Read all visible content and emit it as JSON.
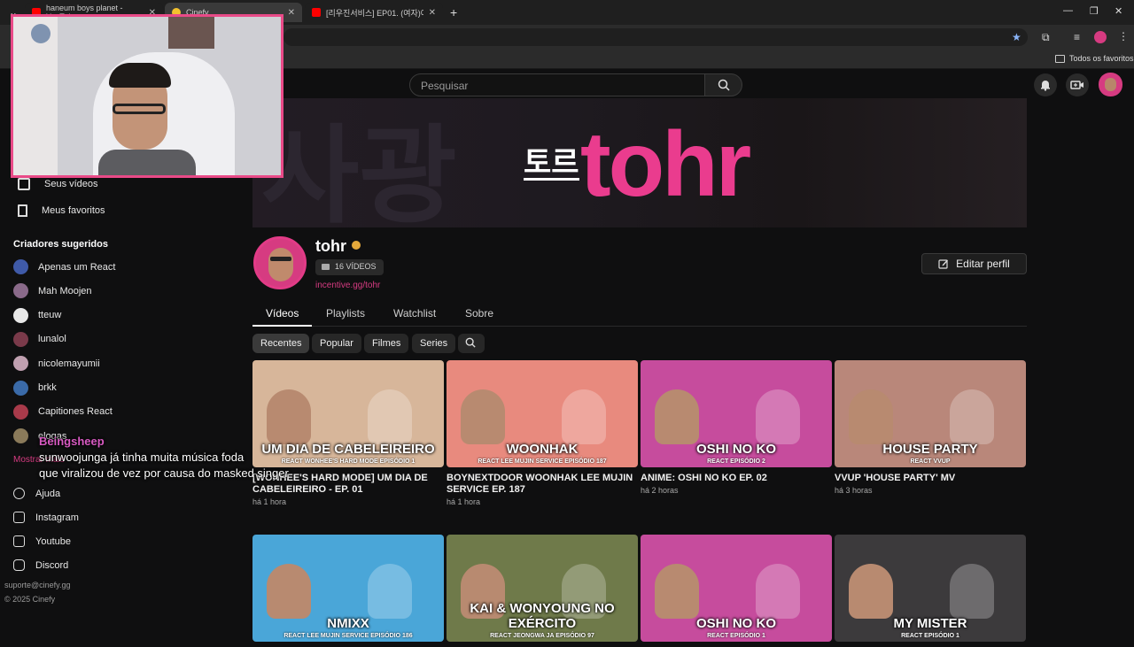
{
  "browser": {
    "tabs": [
      {
        "title": "haneum boys planet - YouTube",
        "favicon": "youtube-icon"
      },
      {
        "title": "Cinefy",
        "favicon": "cinefy-icon"
      },
      {
        "title": "[리우진서비스] EP01. (여자)아이들",
        "favicon": "youtube-icon"
      }
    ],
    "new_tab": "+",
    "bookmarks_label": "Todos os favoritos"
  },
  "header": {
    "search_placeholder": "Pesquisar"
  },
  "banner": {
    "korean": "토르",
    "name": "tohr"
  },
  "channel": {
    "name": "tohr",
    "video_count": "16 VÍDEOS",
    "link": "incentive.gg/tohr",
    "edit_label": "Editar perfil",
    "tabs": [
      "Vídeos",
      "Playlists",
      "Watchlist",
      "Sobre"
    ],
    "chips": [
      "Recentes",
      "Popular",
      "Filmes",
      "Series"
    ]
  },
  "videos": [
    {
      "thumb_title": "UM DIA DE CABELEIREIRO",
      "thumb_sub": "REACT WONHEE'S HARD MODE EPISÓDIO 1",
      "title": "[WONHEE'S HARD MODE] UM DIA DE CABELEIREIRO - EP. 01",
      "time": "há 1 hora",
      "bg": "#d7b69a"
    },
    {
      "thumb_title": "WOONHAK",
      "thumb_sub": "REACT LEE MUJIN SERVICE EPISÓDIO 187",
      "title": "BOYNEXTDOOR WOONHAK LEE MUJIN SERVICE EP. 187",
      "time": "há 1 hora",
      "bg": "#e88a7e"
    },
    {
      "thumb_title": "OSHI NO KO",
      "thumb_sub": "REACT EPISÓDIO 2",
      "title": "ANIME: OSHI NO KO EP. 02",
      "time": "há 2 horas",
      "bg": "#c64c9d"
    },
    {
      "thumb_title": "HOUSE PARTY",
      "thumb_sub": "REACT VVUP",
      "title": "VVUP 'HOUSE PARTY' MV",
      "time": "há 3 horas",
      "bg": "#b9877a"
    },
    {
      "thumb_title": "NMIXX",
      "thumb_sub": "REACT LEE MUJIN SERVICE EPISÓDIO 186",
      "title": "",
      "time": "",
      "bg": "#4aa6d8"
    },
    {
      "thumb_title": "KAI & WONYOUNG NO EXÉRCITO",
      "thumb_sub": "REACT JEONGWA JA EPISÓDIO 97",
      "title": "",
      "time": "",
      "bg": "#6f7a4a"
    },
    {
      "thumb_title": "OSHI NO KO",
      "thumb_sub": "REACT EPISÓDIO 1",
      "title": "",
      "time": "",
      "bg": "#c64c9d"
    },
    {
      "thumb_title": "MY MISTER",
      "thumb_sub": "REACT EPISÓDIO 1",
      "title": "",
      "time": "",
      "bg": "#3c3a3c"
    }
  ],
  "sidebar": {
    "nav": [
      "Seus vídeos",
      "Meus favoritos"
    ],
    "suggested_title": "Criadores sugeridos",
    "creators": [
      {
        "name": "Apenas um React",
        "color": "#3f5aa8"
      },
      {
        "name": "Mah Moojen",
        "color": "#8a6a8a"
      },
      {
        "name": "tteuw",
        "color": "#e8e8e8"
      },
      {
        "name": "lunalol",
        "color": "#7a3a4a"
      },
      {
        "name": "nicolemayumii",
        "color": "#c0a0b0"
      },
      {
        "name": "brkk",
        "color": "#3a6aa8"
      },
      {
        "name": "Capitiones React",
        "color": "#a83a4a"
      },
      {
        "name": "elogas",
        "color": "#8a7a5a"
      }
    ],
    "show_more": "Mostrar mais",
    "footer_links": [
      "Ajuda",
      "Instagram",
      "Youtube",
      "Discord"
    ],
    "support_email": "suporte@cinefy.gg",
    "copyright": "© 2025 Cinefy"
  },
  "chat_overlay": {
    "nick": "Beingsheep",
    "line1": "sunwoojunga já tinha muita música foda",
    "line2": "que viralizou de vez por causa do masked singer"
  },
  "colors": {
    "accent": "#e23b87",
    "background": "#0f0f10"
  }
}
